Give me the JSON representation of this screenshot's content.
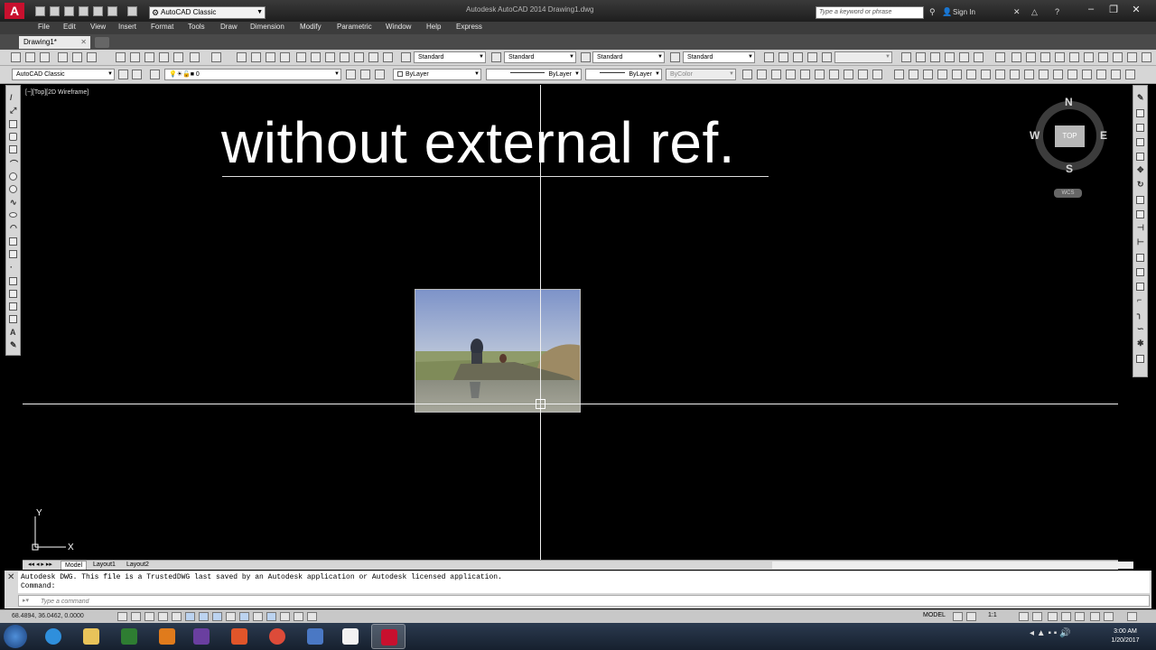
{
  "app": {
    "window_title": "Autodesk AutoCAD 2014    Drawing1.dwg",
    "workspace": "AutoCAD Classic",
    "search_placeholder": "Type a keyword or phrase",
    "sign_in": "Sign In"
  },
  "menu": [
    "File",
    "Edit",
    "View",
    "Insert",
    "Format",
    "Tools",
    "Draw",
    "Dimension",
    "Modify",
    "Parametric",
    "Window",
    "Help",
    "Express"
  ],
  "tab": {
    "label": "Drawing1*"
  },
  "toolbar1": {
    "text_style": "Standard",
    "dim_style": "Standard",
    "table_style": "Standard",
    "mleader_style": "Standard"
  },
  "toolbar2": {
    "workspace": "AutoCAD Classic",
    "layer": "0",
    "color": "ByLayer",
    "linetype": "ByLayer",
    "lineweight": "ByLayer",
    "plot_style": "ByColor"
  },
  "drawing": {
    "viewport_label": "[−][Top][2D Wireframe]",
    "heading": "without external ref.",
    "viewcube": {
      "top": "TOP",
      "north": "N",
      "south": "S",
      "east": "E",
      "west": "W",
      "wcs": "WCS"
    },
    "ucs_x": "X",
    "ucs_y": "Y"
  },
  "layout_tabs": [
    "Model",
    "Layout1",
    "Layout2"
  ],
  "command": {
    "history_line": "Autodesk DWG.  This file is a TrustedDWG last saved by an Autodesk application or Autodesk licensed application.",
    "prompt_line": "Command:",
    "placeholder": "Type a command"
  },
  "status": {
    "coordinates": "68.4894, 36.0462, 0.0000",
    "model": "MODEL",
    "anno_scale": "1:1"
  },
  "clock": {
    "time": "3:00 AM",
    "date": "1/20/2017"
  },
  "colors": {
    "app_red": "#c8102e",
    "drawing_bg": "#000000",
    "toolbar_bg": "#d6d6d6"
  }
}
